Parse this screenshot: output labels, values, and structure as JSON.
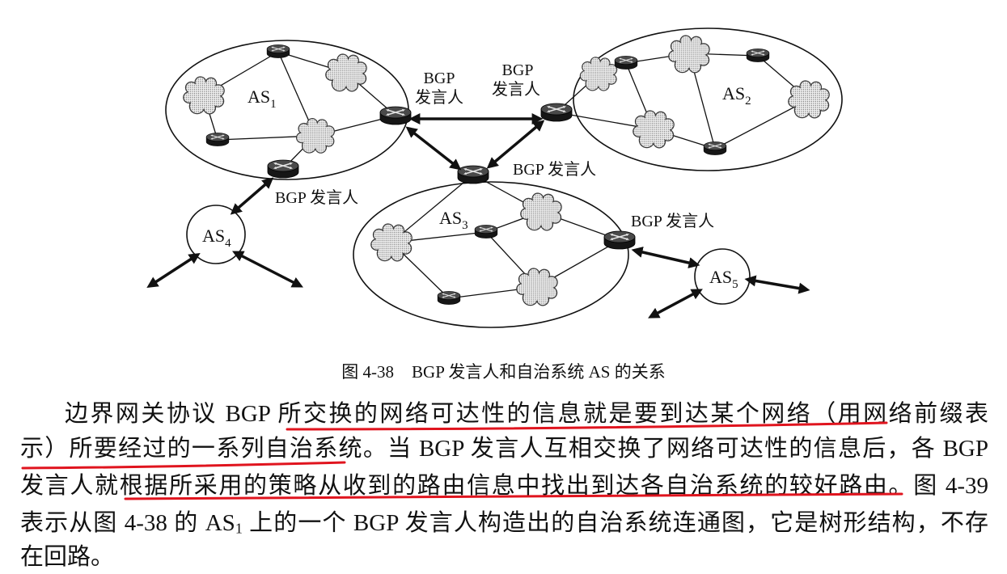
{
  "figure": {
    "as_labels": {
      "as1": {
        "base": "AS",
        "sub": "1"
      },
      "as2": {
        "base": "AS",
        "sub": "2"
      },
      "as3": {
        "base": "AS",
        "sub": "3"
      },
      "as4": {
        "base": "AS",
        "sub": "4"
      },
      "as5": {
        "base": "AS",
        "sub": "5"
      }
    },
    "speaker_labels": {
      "as1_link_speaker": {
        "line1": "BGP",
        "line2": "发言人"
      },
      "as2_link_speaker": {
        "line1": "BGP",
        "line2": "发言人"
      },
      "as3_top_speaker": "BGP 发言人",
      "as1_bottom_speaker": "BGP 发言人",
      "as3_right_speaker": "BGP 发言人"
    },
    "caption": {
      "number": "图 4-38",
      "title": "BGP 发言人和自治系统 AS 的关系"
    },
    "icons": {
      "router": "router-icon",
      "network": "network-cloud-icon"
    }
  },
  "paragraph": {
    "line1": "边界网关协议 BGP 所交换的网络可达性的信息就是要到达某个网络（用网络前缀表",
    "line2": "示）所要经过的一系列自治系统。当 BGP 发言人互相交换了网络可达性的信息后，各 BGP",
    "line3": "发言人就根据所采用的策略从收到的路由信息中找出到达各自治系统的较好路由。图 4-39",
    "line4": {
      "before": "表示从图 4-38 的 AS",
      "sub": "1",
      "after": " 上的一个 BGP 发言人构造出的自治系统连通图，它是树形结构，不存"
    },
    "line5": "在回路。"
  },
  "annotations": {
    "underline_color": "#e0141e"
  }
}
